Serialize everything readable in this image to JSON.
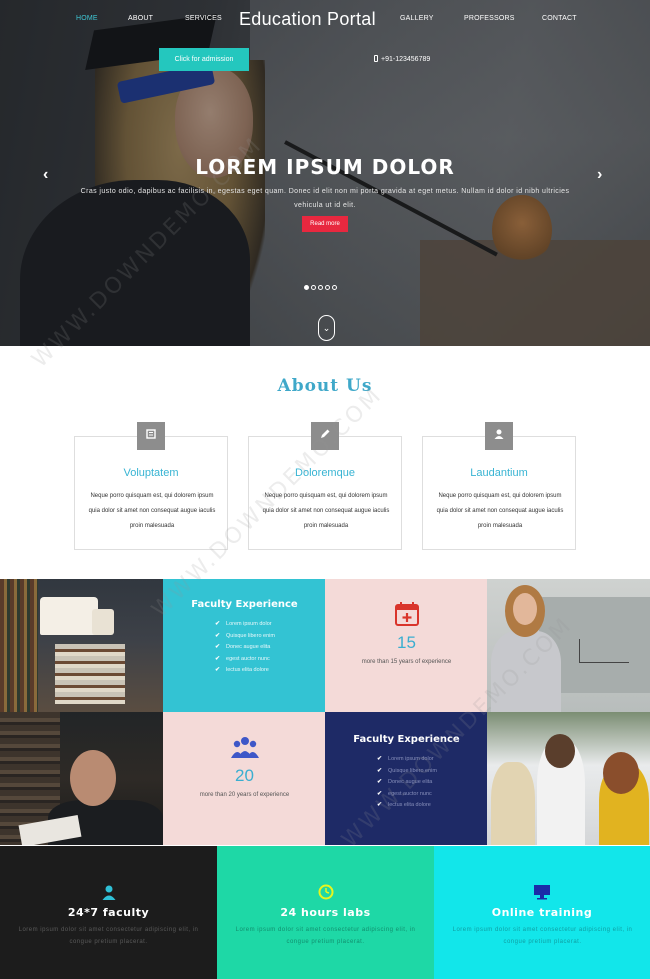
{
  "nav": {
    "items": [
      "HOME",
      "ABOUT",
      "SERVICES",
      "GALLERY",
      "PROFESSORS",
      "CONTACT"
    ],
    "brand": "Education Portal",
    "admission_button": "Click for admission",
    "phone": "+91-123456789"
  },
  "hero": {
    "title": "LOREM IPSUM DOLOR",
    "text": "Cras justo odio, dapibus ac facilisis in, egestas eget quam. Donec id elit non mi porta gravida at eget metus. Nullam id dolor id nibh ultricies vehicula ut id elit.",
    "button": "Read more",
    "arrow_left": "‹",
    "arrow_right": "›",
    "scroll_icon": "⌄"
  },
  "about": {
    "title": "About Us",
    "cards": [
      {
        "icon": "book-icon",
        "title": "Voluptatem",
        "text": "Neque porro quisquam est, qui dolorem ipsum quia dolor sit amet non consequat augue iaculis proin malesuada"
      },
      {
        "icon": "pencil-icon",
        "title": "Doloremque",
        "text": "Neque porro quisquam est, qui dolorem ipsum quia dolor sit amet non consequat augue iaculis proin malesuada"
      },
      {
        "icon": "user-icon",
        "title": "Laudantium",
        "text": "Neque porro quisquam est, qui dolorem ipsum quia dolor sit amet non consequat augue iaculis proin malesuada"
      }
    ]
  },
  "features": {
    "cyan": {
      "heading": "Faculty Experience",
      "list": [
        "Lorem ipsum dolor",
        "Quisque libero enim",
        "Donec augue elita",
        "egest auctor nunc",
        "lectus elita dolore"
      ]
    },
    "stat1": {
      "number": "15",
      "label": "more than 15 years of experience",
      "icon": "calendar-plus-icon"
    },
    "stat2": {
      "number": "20",
      "label": "more than 20 years of experience",
      "icon": "users-icon"
    },
    "navy": {
      "heading": "Faculty Experience",
      "list": [
        "Lorem ipsum dolor",
        "Quisque libero enim",
        "Donec augue elita",
        "egest auctor nunc",
        "lectus elita dolore"
      ]
    }
  },
  "bottom": [
    {
      "icon": "user-icon",
      "title": "24*7 faculty",
      "text": "Lorem ipsum dolor sit amet consectetur adipiscing elit, in congue pretium placerat."
    },
    {
      "icon": "clock-icon",
      "title": "24 hours labs",
      "text": "Lorem ipsum dolor sit amet consectetur adipiscing elit, in congue pretium placerat."
    },
    {
      "icon": "monitor-icon",
      "title": "Online training",
      "text": "Lorem ipsum dolor sit amet consectetur adipiscing elit, in congue pretium placerat."
    }
  ],
  "watermark": "WWW.DOWNDEMO.COM",
  "colors": {
    "accent": "#24c7be",
    "about_title": "#3fa8c9",
    "read_more": "#e8283f",
    "cyan": "#33c3d3",
    "pink": "#f4dad8",
    "navy": "#1e2a66",
    "stat_red": "#d9342b",
    "stat_blue": "#3e57c8",
    "bottom_dark": "#1c1c1c",
    "bottom_green": "#1ed8a6",
    "bottom_cyan": "#12e6ea"
  },
  "slider": {
    "slides": 5,
    "active": 1
  }
}
